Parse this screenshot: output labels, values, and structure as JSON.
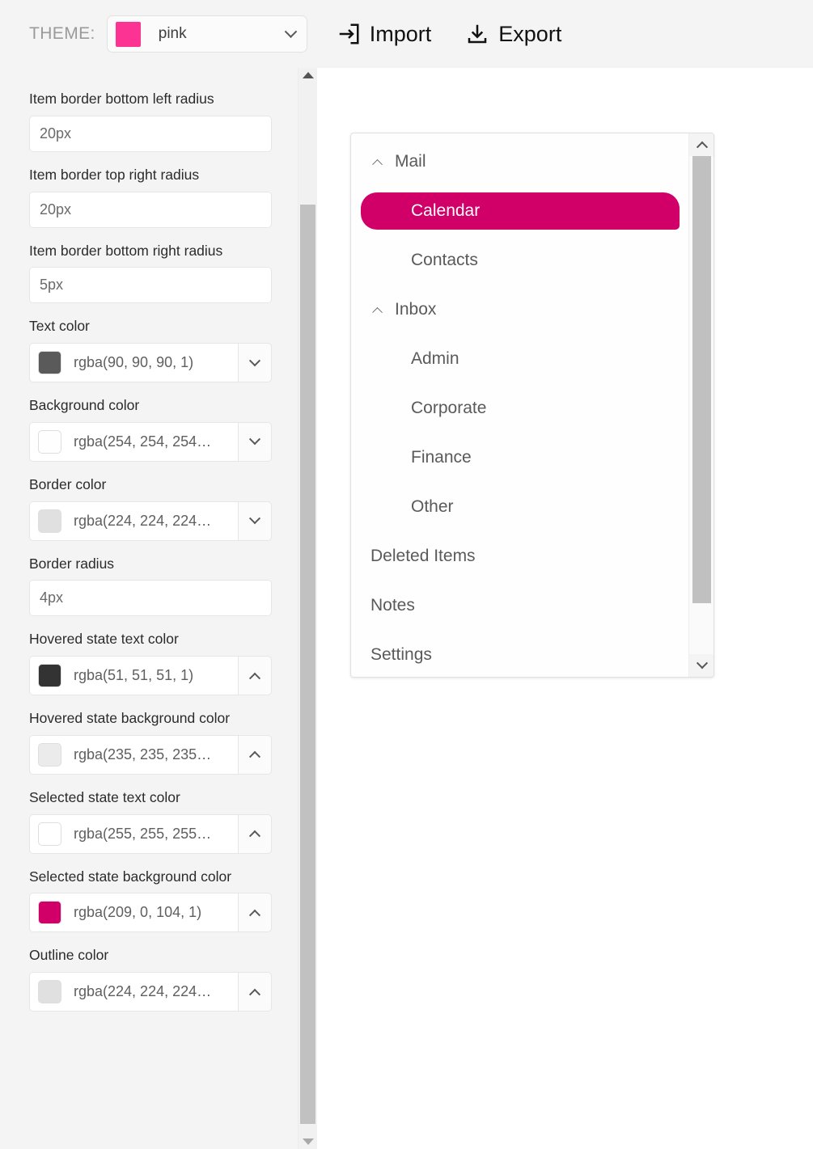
{
  "header": {
    "theme_label": "THEME:",
    "theme_value": "pink",
    "theme_swatch_color": "#fd3394",
    "theme_chevron_icon": "chevron-down-icon",
    "import_label": "Import",
    "import_icon": "import-icon",
    "export_label": "Export",
    "export_icon": "export-icon",
    "background_color": "#f4f4f4"
  },
  "sidebar": {
    "background_color": "#f4f4f4",
    "fields": [
      {
        "type": "text",
        "label": "",
        "value": "",
        "clipped": true
      },
      {
        "type": "text",
        "label": "Item border bottom left radius",
        "value": "20px"
      },
      {
        "type": "text",
        "label": "Item border top right radius",
        "value": "20px"
      },
      {
        "type": "text",
        "label": "Item border bottom right radius",
        "value": "5px"
      },
      {
        "type": "color",
        "label": "Text color",
        "value": "rgba(90, 90, 90, 1)",
        "swatch": "#5a5a5a",
        "chevron": "chevron-down-icon"
      },
      {
        "type": "color",
        "label": "Background color",
        "value": "rgba(254, 254, 254…",
        "swatch": "#fefefe",
        "chevron": "chevron-down-icon"
      },
      {
        "type": "color",
        "label": "Border color",
        "value": "rgba(224, 224, 224…",
        "swatch": "#e0e0e0",
        "chevron": "chevron-down-icon"
      },
      {
        "type": "text",
        "label": "Border radius",
        "value": "4px"
      },
      {
        "type": "color",
        "label": "Hovered state text color",
        "value": "rgba(51, 51, 51, 1)",
        "swatch": "#333333",
        "chevron": "chevron-up-icon"
      },
      {
        "type": "color",
        "label": "Hovered state background color",
        "value": "rgba(235, 235, 235…",
        "swatch": "#ebebeb",
        "chevron": "chevron-up-icon"
      },
      {
        "type": "color",
        "label": "Selected state text color",
        "value": "rgba(255, 255, 255…",
        "swatch": "#ffffff",
        "chevron": "chevron-up-icon"
      },
      {
        "type": "color",
        "label": "Selected state background color",
        "value": "rgba(209, 0, 104, 1)",
        "swatch": "#d10068",
        "chevron": "chevron-up-icon"
      },
      {
        "type": "color",
        "label": "Outline color",
        "value": "rgba(224, 224, 224…",
        "swatch": "#e0e0e0",
        "chevron": "chevron-up-icon"
      }
    ],
    "scrollbar": {
      "up_arrow_icon": "scroll-up-arrow-icon",
      "down_arrow_icon": "scroll-down-arrow-icon"
    }
  },
  "preview": {
    "tree": {
      "selected_background_color": "#d10068",
      "selected_text_color": "#ffffff",
      "text_color": "#5a5a5a",
      "items": [
        {
          "label": "Mail",
          "level": "group",
          "expanded": true,
          "selected": false,
          "expander_icon": "chevron-up-icon"
        },
        {
          "label": "Calendar",
          "level": "child",
          "expanded": false,
          "selected": true
        },
        {
          "label": "Contacts",
          "level": "child",
          "expanded": false,
          "selected": false
        },
        {
          "label": "Inbox",
          "level": "group",
          "expanded": true,
          "selected": false,
          "expander_icon": "chevron-up-icon"
        },
        {
          "label": "Admin",
          "level": "child",
          "expanded": false,
          "selected": false
        },
        {
          "label": "Corporate",
          "level": "child",
          "expanded": false,
          "selected": false
        },
        {
          "label": "Finance",
          "level": "child",
          "expanded": false,
          "selected": false
        },
        {
          "label": "Other",
          "level": "child",
          "expanded": false,
          "selected": false
        },
        {
          "label": "Deleted Items",
          "level": "group",
          "expanded": false,
          "selected": false
        },
        {
          "label": "Notes",
          "level": "group",
          "expanded": false,
          "selected": false
        },
        {
          "label": "Settings",
          "level": "group",
          "expanded": false,
          "selected": false
        }
      ],
      "scrollbar": {
        "up_icon": "chevron-up-icon",
        "down_icon": "chevron-down-icon"
      }
    }
  }
}
